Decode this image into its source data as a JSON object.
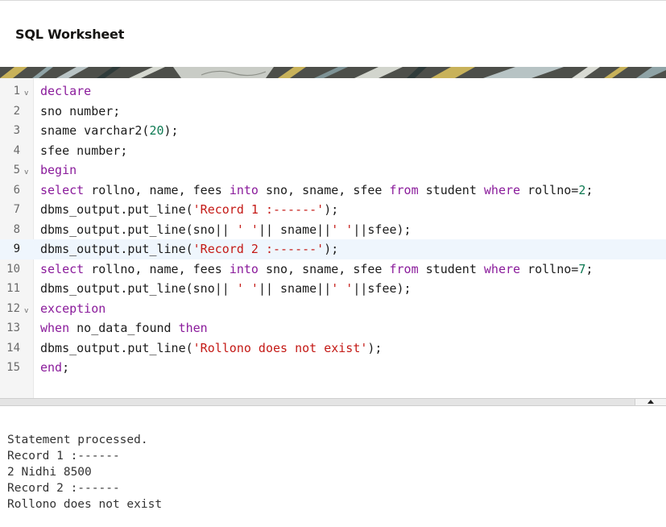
{
  "page": {
    "title": "SQL Worksheet"
  },
  "editor": {
    "active_line": 9,
    "lines": [
      {
        "n": "1",
        "fold": "v",
        "tokens": [
          {
            "t": "kw",
            "v": "declare"
          }
        ]
      },
      {
        "n": "2",
        "fold": "",
        "tokens": [
          {
            "t": "",
            "v": "sno number;"
          }
        ]
      },
      {
        "n": "3",
        "fold": "",
        "tokens": [
          {
            "t": "",
            "v": "sname varchar2("
          },
          {
            "t": "num",
            "v": "20"
          },
          {
            "t": "",
            "v": ");"
          }
        ]
      },
      {
        "n": "4",
        "fold": "",
        "tokens": [
          {
            "t": "",
            "v": "sfee number;"
          }
        ]
      },
      {
        "n": "5",
        "fold": "v",
        "tokens": [
          {
            "t": "kw",
            "v": "begin"
          }
        ]
      },
      {
        "n": "6",
        "fold": "",
        "tokens": [
          {
            "t": "kw",
            "v": "select"
          },
          {
            "t": "",
            "v": " rollno, name, fees "
          },
          {
            "t": "kw",
            "v": "into"
          },
          {
            "t": "",
            "v": " sno, sname, sfee "
          },
          {
            "t": "kw",
            "v": "from"
          },
          {
            "t": "",
            "v": " student "
          },
          {
            "t": "kw",
            "v": "where"
          },
          {
            "t": "",
            "v": " rollno="
          },
          {
            "t": "num",
            "v": "2"
          },
          {
            "t": "",
            "v": ";"
          }
        ]
      },
      {
        "n": "7",
        "fold": "",
        "tokens": [
          {
            "t": "",
            "v": "dbms_output.put_line("
          },
          {
            "t": "str",
            "v": "'Record 1 :------'"
          },
          {
            "t": "",
            "v": ");"
          }
        ]
      },
      {
        "n": "8",
        "fold": "",
        "tokens": [
          {
            "t": "",
            "v": "dbms_output.put_line(sno|| "
          },
          {
            "t": "str",
            "v": "' '"
          },
          {
            "t": "",
            "v": "|| sname||"
          },
          {
            "t": "str",
            "v": "' '"
          },
          {
            "t": "",
            "v": "||sfee);"
          }
        ]
      },
      {
        "n": "9",
        "fold": "",
        "tokens": [
          {
            "t": "",
            "v": "dbms_output.put_line("
          },
          {
            "t": "str",
            "v": "'Record 2 :------'"
          },
          {
            "t": "",
            "v": ");"
          }
        ]
      },
      {
        "n": "10",
        "fold": "",
        "tokens": [
          {
            "t": "kw",
            "v": "select"
          },
          {
            "t": "",
            "v": " rollno, name, fees "
          },
          {
            "t": "kw",
            "v": "into"
          },
          {
            "t": "",
            "v": " sno, sname, sfee "
          },
          {
            "t": "kw",
            "v": "from"
          },
          {
            "t": "",
            "v": " student "
          },
          {
            "t": "kw",
            "v": "where"
          },
          {
            "t": "",
            "v": " rollno="
          },
          {
            "t": "num",
            "v": "7"
          },
          {
            "t": "",
            "v": ";"
          }
        ]
      },
      {
        "n": "11",
        "fold": "",
        "tokens": [
          {
            "t": "",
            "v": "dbms_output.put_line(sno|| "
          },
          {
            "t": "str",
            "v": "' '"
          },
          {
            "t": "",
            "v": "|| sname||"
          },
          {
            "t": "str",
            "v": "' '"
          },
          {
            "t": "",
            "v": "||sfee);"
          }
        ]
      },
      {
        "n": "12",
        "fold": "v",
        "tokens": [
          {
            "t": "kw",
            "v": "exception"
          }
        ]
      },
      {
        "n": "13",
        "fold": "",
        "tokens": [
          {
            "t": "kw",
            "v": "when"
          },
          {
            "t": "",
            "v": " no_data_found "
          },
          {
            "t": "kw",
            "v": "then"
          }
        ]
      },
      {
        "n": "14",
        "fold": "",
        "tokens": [
          {
            "t": "",
            "v": "dbms_output.put_line("
          },
          {
            "t": "str",
            "v": "'Rollono does not exist'"
          },
          {
            "t": "",
            "v": ");"
          }
        ]
      },
      {
        "n": "15",
        "fold": "",
        "tokens": [
          {
            "t": "kw",
            "v": "end"
          },
          {
            "t": "",
            "v": ";"
          }
        ]
      }
    ]
  },
  "splitter": {
    "toggle_icon": "triangle-up-icon"
  },
  "output": {
    "lines": [
      "Statement processed.",
      "Record 1 :------",
      "2 Nidhi 8500",
      "Record 2 :------",
      "Rollono does not exist"
    ]
  }
}
